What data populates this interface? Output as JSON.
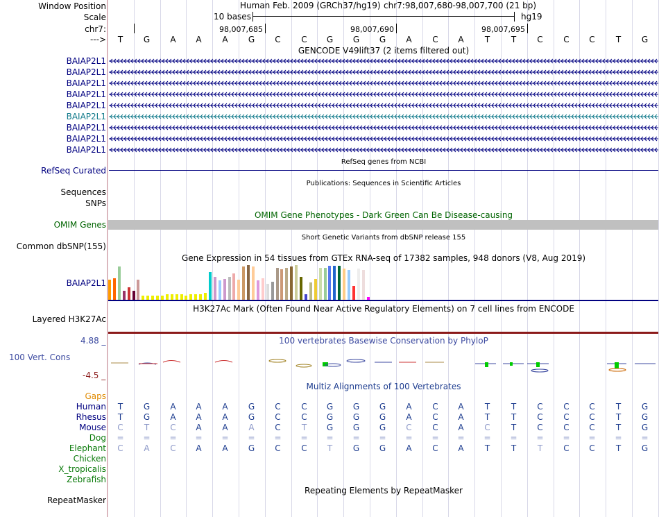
{
  "header": {
    "window_position_label": "Window Position",
    "scale_label": "Scale",
    "chr_label": "chr7:",
    "arrow_label": "--->",
    "assembly_title": "Human Feb. 2009 (GRCh37/hg19)",
    "position_text": "chr7:98,007,680-98,007,700 (21 bp)",
    "scale_text": "10 bases",
    "db_text": "hg19",
    "coord_ticks": [
      "98,007,685",
      "98,007,690",
      "98,007,695"
    ]
  },
  "bases": [
    "T",
    "G",
    "A",
    "A",
    "A",
    "G",
    "C",
    "C",
    "G",
    "G",
    "G",
    "A",
    "C",
    "A",
    "T",
    "T",
    "C",
    "C",
    "C",
    "T",
    "G"
  ],
  "gencode": {
    "title": "GENCODE V49lift37 (2 items filtered out)",
    "items": [
      "BAIAP2L1",
      "BAIAP2L1",
      "BAIAP2L1",
      "BAIAP2L1",
      "BAIAP2L1",
      "BAIAP2L1",
      "BAIAP2L1",
      "BAIAP2L1",
      "BAIAP2L1"
    ],
    "highlight_index": 5
  },
  "refseq": {
    "title": "RefSeq genes from NCBI",
    "label": "RefSeq Curated"
  },
  "publications": {
    "title": "Publications: Sequences in Scientific Articles",
    "label": "Sequences"
  },
  "snps": {
    "label": "SNPs"
  },
  "omim": {
    "title": "OMIM Gene Phenotypes - Dark Green Can Be Disease-causing",
    "label": "OMIM Genes"
  },
  "dbsnp": {
    "title": "Short Genetic Variants from dbSNP release 155",
    "label": "Common dbSNP(155)"
  },
  "gtex": {
    "title": "Gene Expression in 54 tissues from GTEx RNA-seq of 17382 samples, 948 donors (V8, Aug 2019)",
    "label": "BAIAP2L1",
    "levels": [
      0.58,
      0.62,
      0.95,
      0.25,
      0.35,
      0.25,
      0.58,
      0.12,
      0.12,
      0.12,
      0.12,
      0.12,
      0.15,
      0.15,
      0.15,
      0.15,
      0.12,
      0.15,
      0.15,
      0.15,
      0.2,
      0.8,
      0.65,
      0.55,
      0.6,
      0.65,
      0.75,
      0.58,
      0.95,
      1.0,
      0.95,
      0.55,
      0.62,
      0.45,
      0.52,
      0.92,
      0.88,
      0.92,
      0.95,
      1.0,
      0.65,
      0.15,
      0.5,
      0.6,
      0.92,
      0.92,
      0.98,
      0.97,
      0.98,
      0.9,
      0.85,
      0.4,
      0.9,
      0.85,
      0.08
    ],
    "colors": [
      "#ff9900",
      "#ff6600",
      "#99cc99",
      "#993366",
      "#cc3333",
      "#660033",
      "#cc9999",
      "#eeee00",
      "#eeee00",
      "#eeee00",
      "#eeee00",
      "#eeee00",
      "#eeee00",
      "#eeee00",
      "#eeee00",
      "#eeee00",
      "#eeee00",
      "#eeee00",
      "#eeee00",
      "#eeee00",
      "#eeee00",
      "#00cccc",
      "#cc99cc",
      "#99ccff",
      "#cc99cc",
      "#bbbbbb",
      "#eeaaaa",
      "#ffcc99",
      "#cc9966",
      "#886644",
      "#ffcc99",
      "#dd99dd",
      "#ffcccc",
      "#dddddd",
      "#999999",
      "#aa9988",
      "#cc9977",
      "#bbaa88",
      "#886633",
      "#cccc99",
      "#666600",
      "#4444cc",
      "#bbbb88",
      "#eecc33",
      "#ccddaa",
      "#99cc99",
      "#5577ee",
      "#2266cc",
      "#006633",
      "#ffcc88",
      "#99ccff",
      "#ff3333",
      "#eeeeee",
      "#eedddd",
      "#ff00ff"
    ]
  },
  "h3k27ac": {
    "title": "H3K27Ac Mark (Often Found Near Active Regulatory Elements) on 7 cell lines from ENCODE",
    "label": "Layered H3K27Ac"
  },
  "phylop": {
    "title": "100 vertebrates Basewise Conservation by PhyloP",
    "label": "100 Vert. Cons",
    "max_label": "4.88 _",
    "min_label": "-4.5 _"
  },
  "multiz": {
    "title": "Multiz Alignments of 100 Vertebrates",
    "gaps_label": "Gaps",
    "species": [
      {
        "name": "Human",
        "seq": [
          "T",
          "G",
          "A",
          "A",
          "A",
          "G",
          "C",
          "C",
          "G",
          "G",
          "G",
          "A",
          "C",
          "A",
          "T",
          "T",
          "C",
          "C",
          "C",
          "T",
          "G"
        ],
        "dim": []
      },
      {
        "name": "Rhesus",
        "seq": [
          "T",
          "G",
          "A",
          "A",
          "A",
          "G",
          "C",
          "C",
          "G",
          "G",
          "G",
          "A",
          "C",
          "A",
          "T",
          "T",
          "C",
          "C",
          "C",
          "T",
          "G"
        ],
        "dim": []
      },
      {
        "name": "Mouse",
        "seq": [
          "C",
          "T",
          "C",
          "A",
          "A",
          "A",
          "C",
          "T",
          "G",
          "G",
          "G",
          "C",
          "C",
          "A",
          "C",
          "T",
          "C",
          "C",
          "C",
          "T",
          "G"
        ],
        "dim": [
          0,
          1,
          2,
          5,
          7,
          11,
          14
        ]
      },
      {
        "name": "Dog",
        "seq": [
          "=",
          "=",
          "=",
          "=",
          "=",
          "=",
          "=",
          "=",
          "=",
          "=",
          "=",
          "=",
          "=",
          "=",
          "=",
          "=",
          "=",
          "=",
          "=",
          "=",
          "="
        ],
        "dim": []
      },
      {
        "name": "Elephant",
        "seq": [
          "C",
          "A",
          "C",
          "A",
          "A",
          "G",
          "C",
          "C",
          "T",
          "G",
          "G",
          "A",
          "C",
          "A",
          "T",
          "T",
          "T",
          "C",
          "C",
          "T",
          "G"
        ],
        "dim": [
          0,
          1,
          2,
          8,
          16
        ]
      },
      {
        "name": "Chicken",
        "seq": [],
        "dim": []
      },
      {
        "name": "X_tropicalis",
        "seq": [],
        "dim": []
      },
      {
        "name": "Zebrafish",
        "seq": [],
        "dim": []
      }
    ]
  },
  "repeatmasker": {
    "title": "Repeating Elements by RepeatMasker",
    "label": "RepeatMasker"
  },
  "colors": {
    "navy": "#000080",
    "teal": "#117a8b",
    "omim_green": "#006400",
    "phylop_blue": "#3c4aa0",
    "multiz_blue": "#1d3c8f",
    "gaps_orange": "#e08a00",
    "species_green": "#0a7a0a",
    "min_red": "#8b1a1a",
    "omim_bar": "#c0c0c0"
  }
}
